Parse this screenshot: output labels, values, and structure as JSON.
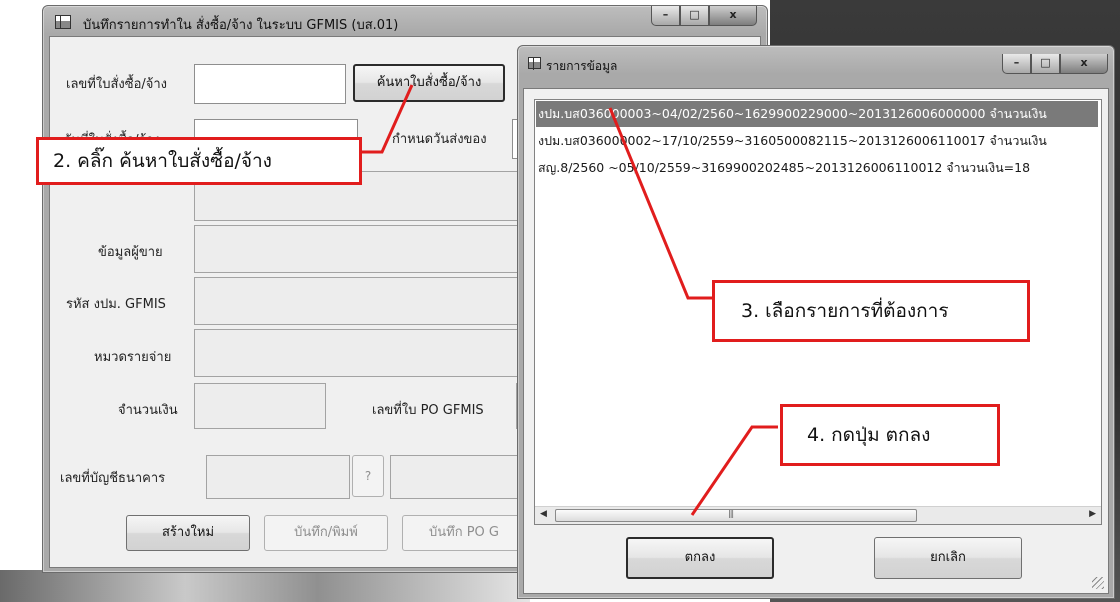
{
  "main_window": {
    "title": "บันทึกรายการทำใน สั่งซื้อ/จ้าง ในระบบ GFMIS (บส.01)",
    "controls": {
      "minimize": "–",
      "maximize": "□",
      "close": "x"
    },
    "labels": {
      "po_number": "เลขที่ใบสั่งซื้อ/จ้าง",
      "po_date": "วันที่ใบสั่งซื้อ/จ้าง",
      "delivery_date": "กำหนดวันส่งของ",
      "vendor_info": "ข้อมูลผู้ขาย",
      "gfmis_budget_code": "รหัส งปม. GFMIS",
      "expense_category": "หมวดรายจ่าย",
      "amount": "จำนวนเงิน",
      "po_gfmis_number": "เลขที่ใบ PO  GFMIS",
      "bank_account": "เลขที่บัญชีธนาคาร"
    },
    "buttons": {
      "search_po": "ค้นหาใบสั่งซื้อ/จ้าง",
      "bank_lookup": "?",
      "create_new": "สร้างใหม่",
      "save_print": "บันทึก/พิมพ์",
      "save_po": "บันทึก PO G"
    }
  },
  "dialog": {
    "title": "รายการข้อมูล",
    "items": [
      "งปม.บส036000003~04/02/2560~1629900229000~2013126006000000 จำนวนเงิน",
      "งปม.บส036000002~17/10/2559~3160500082115~2013126006110017 จำนวนเงิน",
      "สญ.8/2560      ~05/10/2559~3169900202485~2013126006110012 จำนวนเงิน=18"
    ],
    "selected_index": 0,
    "buttons": {
      "ok": "ตกลง",
      "cancel": "ยกเลิก"
    }
  },
  "callouts": {
    "step2": "2. คลิ๊ก ค้นหาใบสั่งซื้อ/จ้าง",
    "step3": "3. เลือกรายการที่ต้องการ",
    "step4": "4. กดปุ่ม ตกลง"
  },
  "colors": {
    "callout_border": "#e11d1d",
    "selection": "#7a7a7a"
  }
}
